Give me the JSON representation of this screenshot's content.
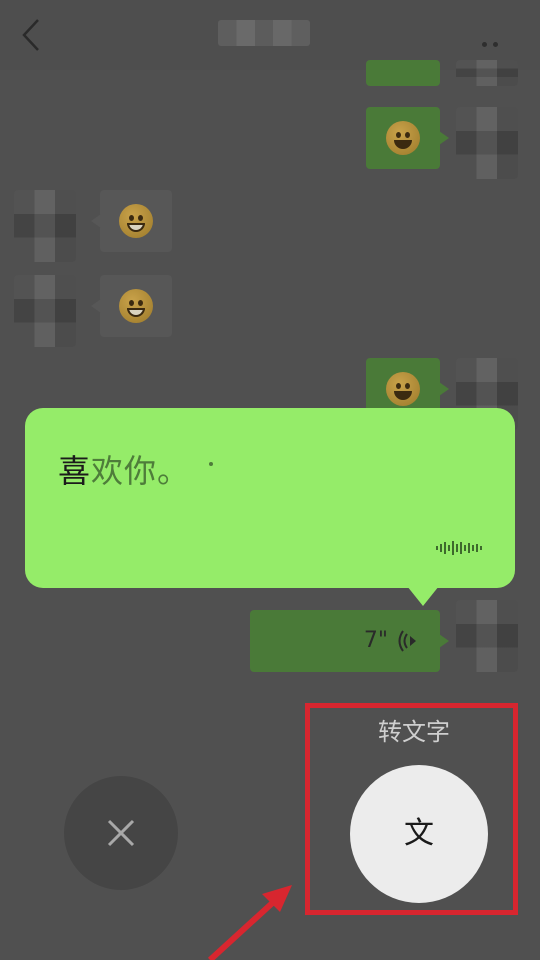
{
  "popup": {
    "text_done": "喜",
    "text_pending": "欢你。"
  },
  "voice": {
    "duration": "7\""
  },
  "controls": {
    "convert_label": "转文字",
    "convert_glyph": "文",
    "cancel_icon": "close-icon"
  },
  "colors": {
    "popup_green": "#95ec69",
    "highlight_red": "#d8262f"
  }
}
